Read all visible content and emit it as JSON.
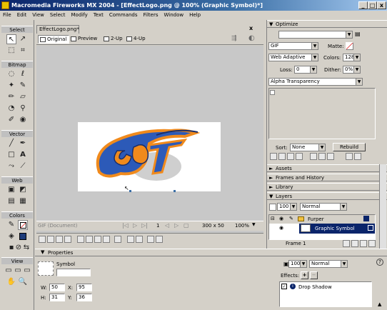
{
  "window": {
    "title": "Macromedia Fireworks MX 2004 - [EffectLogo.png @ 100% (Graphic Symbol)*]"
  },
  "menu": [
    "File",
    "Edit",
    "View",
    "Select",
    "Modify",
    "Text",
    "Commands",
    "Filters",
    "Window",
    "Help"
  ],
  "tools": {
    "select": "Select",
    "bitmap": "Bitmap",
    "vector": "Vector",
    "web": "Web",
    "colors": "Colors",
    "view": "View"
  },
  "document": {
    "tab": "EffectLogo.png*",
    "views": [
      "Original",
      "Preview",
      "2-Up",
      "4-Up"
    ],
    "status_format": "GIF (Document)",
    "frame": "1",
    "size": "300 x 50",
    "zoom": "100%"
  },
  "optimize": {
    "title": "Optimize",
    "format": "GIF",
    "palette": "Web Adaptive",
    "matte_label": "Matte:",
    "colors_label": "Colors:",
    "colors": "128",
    "loss_label": "Loss:",
    "loss": "0",
    "dither_label": "Dither:",
    "dither": "0%",
    "transparency": "Alpha Transparency",
    "sort_label": "Sort:",
    "sort": "None",
    "rebuild": "Rebuild"
  },
  "panels": {
    "assets": "Assets",
    "frames": "Frames and History",
    "library": "Library",
    "layers": "Layers"
  },
  "layers": {
    "opacity": "100",
    "blend": "Normal",
    "layer_name": "Furper",
    "object_name": "Graphic Symbol",
    "frame_label": "Frame 1"
  },
  "properties": {
    "title": "Properties",
    "type": "Symbol",
    "w_label": "W:",
    "w": "50",
    "h_label": "H:",
    "h": "95",
    "x_label": "X:",
    "x": "31",
    "y_label": "Y:",
    "y": "36",
    "opacity": "100",
    "blend": "Normal",
    "effects_label": "Effects:",
    "effect": "Drop Shadow"
  },
  "colors": {
    "titlebar": "#0a246a",
    "selection": "#0a246a",
    "artwork_blue": "#2c5ab8",
    "artwork_orange": "#f08a1c"
  }
}
